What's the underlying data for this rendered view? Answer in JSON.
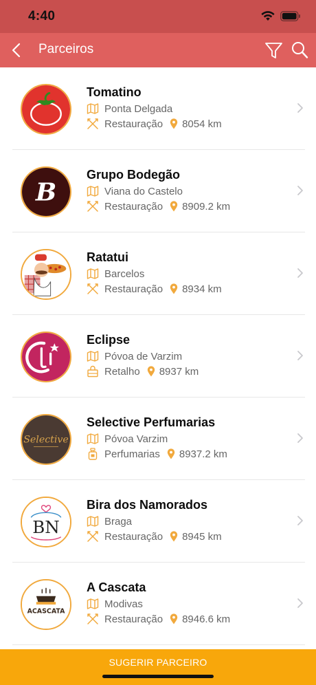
{
  "status_bar": {
    "time": "4:40"
  },
  "nav": {
    "title": "Parceiros"
  },
  "partners": [
    {
      "name": "Tomatino",
      "location": "Ponta Delgada",
      "category": "Restauração",
      "category_icon": "cutlery-icon",
      "distance": "8054 km",
      "logo": "tomatino-logo"
    },
    {
      "name": "Grupo Bodegão",
      "location": "Viana do Castelo",
      "category": "Restauração",
      "category_icon": "cutlery-icon",
      "distance": "8909.2 km",
      "logo": "bodegao-logo"
    },
    {
      "name": "Ratatui",
      "location": "Barcelos",
      "category": "Restauração",
      "category_icon": "cutlery-icon",
      "distance": "8934 km",
      "logo": "ratatui-logo"
    },
    {
      "name": "Eclipse",
      "location": "Póvoa de Varzim",
      "category": "Retalho",
      "category_icon": "shopping-bag-icon",
      "distance": "8937 km",
      "logo": "eclipse-logo"
    },
    {
      "name": "Selective Perfumarias",
      "location": "Póvoa Varzim",
      "category": "Perfumarias",
      "category_icon": "perfume-bottle-icon",
      "distance": "8937.2 km",
      "logo": "selective-logo",
      "logo_text": "Selective"
    },
    {
      "name": "Bira dos Namorados",
      "location": "Braga",
      "category": "Restauração",
      "category_icon": "cutlery-icon",
      "distance": "8945 km",
      "logo": "bira-dos-namorados-logo",
      "logo_text": "BN"
    },
    {
      "name": "A Cascata",
      "location": "Modivas",
      "category": "Restauração",
      "category_icon": "cutlery-icon",
      "distance": "8946.6 km",
      "logo": "a-cascata-logo",
      "logo_text": "ACASCATA"
    }
  ],
  "footer": {
    "suggest_label": "SUGERIR PARCEIRO"
  },
  "colors": {
    "status_bar": "#c84f4e",
    "nav_bar": "#df605e",
    "accent": "#f1a93d",
    "footer": "#f8a70b"
  }
}
